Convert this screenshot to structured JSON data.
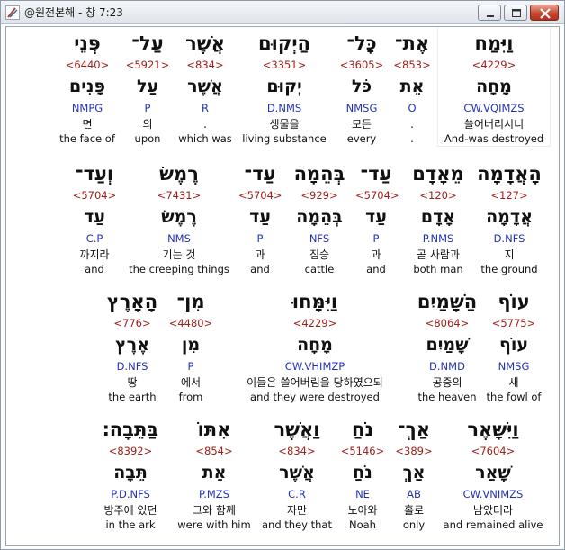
{
  "window": {
    "title": "@원전본해 - 창 7:23",
    "app_icon": "app-logo-icon",
    "controls": [
      "minimize-icon",
      "maximize-icon",
      "close-icon"
    ]
  },
  "rows": [
    {
      "words": [
        {
          "hebrew": "וַיִּמַח",
          "strong": "<4229>",
          "lemma": "מָחָה",
          "morph": "CW.VQIMZS",
          "korean": "쓸어버리시니",
          "english": "And-was destroyed"
        },
        {
          "hebrew": "אֶת־",
          "strong": "<853>",
          "lemma": "אֵת",
          "morph": "O",
          "korean": ".",
          "english": "."
        },
        {
          "hebrew": "כָּל־",
          "strong": "<3605>",
          "lemma": "כֹּל",
          "morph": "NMSG",
          "korean": "모든",
          "english": "every"
        },
        {
          "hebrew": "הַיְקוּם",
          "strong": "<3351>",
          "lemma": "יְקוּם",
          "morph": "D.NMS",
          "korean": "생물을",
          "english": "living substance"
        },
        {
          "hebrew": "אֲשֶׁר",
          "strong": "<834>",
          "lemma": "אֲשֶׁר",
          "morph": "R",
          "korean": ".",
          "english": "which was"
        },
        {
          "hebrew": "עַל־",
          "strong": "<5921>",
          "lemma": "עַל",
          "morph": "P",
          "korean": "의",
          "english": "upon"
        },
        {
          "hebrew": "פְּנֵי",
          "strong": "<6440>",
          "lemma": "פָּנִים",
          "morph": "NMPG",
          "korean": "면",
          "english": "the face of"
        }
      ]
    },
    {
      "words": [
        {
          "hebrew": "הָאֲדָמָה",
          "strong": "<127>",
          "lemma": "אֲדָמָה",
          "morph": "D.NFS",
          "korean": "지",
          "english": "the ground"
        },
        {
          "hebrew": "מֵאָדָם",
          "strong": "<120>",
          "lemma": "אָדָם",
          "morph": "P.NMS",
          "korean": "곧 사람과",
          "english": "both man"
        },
        {
          "hebrew": "עַד־",
          "strong": "<5704>",
          "lemma": "עַד",
          "morph": "P",
          "korean": "과",
          "english": "and"
        },
        {
          "hebrew": "בְּהֵמָה",
          "strong": "<929>",
          "lemma": "בְּהֵמָה",
          "morph": "NFS",
          "korean": "짐승",
          "english": "cattle"
        },
        {
          "hebrew": "עַד־",
          "strong": "<5704>",
          "lemma": "עַד",
          "morph": "P",
          "korean": "과",
          "english": "and"
        },
        {
          "hebrew": "רֶמֶשׂ",
          "strong": "<7431>",
          "lemma": "רֶמֶשׂ",
          "morph": "NMS",
          "korean": "기는 것",
          "english": "the creeping things"
        },
        {
          "hebrew": "וְעַד־",
          "strong": "<5704>",
          "lemma": "עַד",
          "morph": "C.P",
          "korean": "까지라",
          "english": "and"
        }
      ]
    },
    {
      "words": [
        {
          "hebrew": "עוֹף",
          "strong": "<5775>",
          "lemma": "עוֹף",
          "morph": "NMSG",
          "korean": "새",
          "english": "the fowl of"
        },
        {
          "hebrew": "הַשָּׁמַיִם",
          "strong": "<8064>",
          "lemma": "שָׁמַיִם",
          "morph": "D.NMD",
          "korean": "공중의",
          "english": "the heaven"
        },
        {
          "hebrew": "וַיִּמָּחוּ",
          "strong": "<4229>",
          "lemma": "מָחָה",
          "morph": "CW.VHIMZP",
          "korean": "이들은-쓸어버림을 당하였으되",
          "english": "and they were destroyed"
        },
        {
          "hebrew": "מִן־",
          "strong": "<4480>",
          "lemma": "מִן",
          "morph": "P",
          "korean": "에서",
          "english": "from"
        },
        {
          "hebrew": "הָאָרֶץ",
          "strong": "<776>",
          "lemma": "אֶרֶץ",
          "morph": "D.NFS",
          "korean": "땅",
          "english": "the earth"
        }
      ]
    },
    {
      "words": [
        {
          "hebrew": "וַיִּשָּׁאֶר",
          "strong": "<7604>",
          "lemma": "שָׁאַר",
          "morph": "CW.VNIMZS",
          "korean": "남았더라",
          "english": "and remained alive"
        },
        {
          "hebrew": "אַךְ־",
          "strong": "<389>",
          "lemma": "אַךְ",
          "morph": "AB",
          "korean": "홀로",
          "english": "only"
        },
        {
          "hebrew": "נֹחַ",
          "strong": "<5146>",
          "lemma": "נֹחַ",
          "morph": "NE",
          "korean": "노아와",
          "english": "Noah"
        },
        {
          "hebrew": "וַאֲשֶׁר",
          "strong": "<834>",
          "lemma": "אֲשֶׁר",
          "morph": "C.R",
          "korean": "자만",
          "english": "and they that"
        },
        {
          "hebrew": "אִתּוֹ",
          "strong": "<854>",
          "lemma": "אֵת",
          "morph": "P.MZS",
          "korean": "그와 함께",
          "english": "were with him"
        },
        {
          "hebrew": "בַּתֵּבָה׃",
          "strong": "<8392>",
          "lemma": "תֵּבָה",
          "morph": "P.D.NFS",
          "korean": "방주에 있던",
          "english": "in the ark"
        }
      ]
    }
  ]
}
